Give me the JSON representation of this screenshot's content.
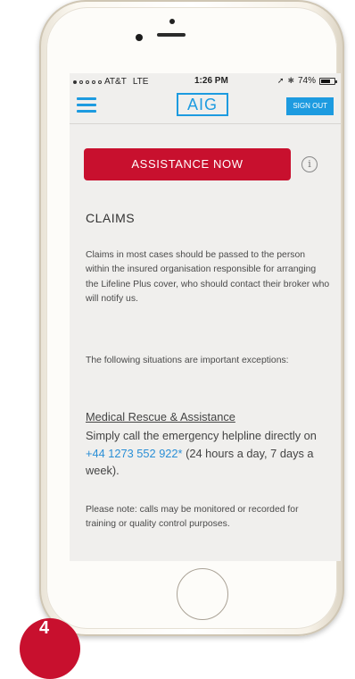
{
  "status_bar": {
    "carrier": "AT&T",
    "network": "LTE",
    "time": "1:26 PM",
    "battery": "74%",
    "battery_level": 0.74
  },
  "app_bar": {
    "logo": "AIG",
    "sign_out_label": "SIGN OUT"
  },
  "main": {
    "assistance_label": "ASSISTANCE NOW",
    "info_symbol": "i",
    "heading": "CLAIMS",
    "paragraph_1": "Claims in most cases should be passed to the person within the insured organisation responsible for arranging the Lifeline Plus cover, who should contact their broker who will notify us.",
    "paragraph_2": "The following situations are important exceptions:",
    "medical_title": "Medical Rescue & Assistance",
    "medical_text_before": "Simply call the emergency helpline directly on ",
    "medical_phone": "+44 1273 552 922*",
    "medical_text_after": " (24 hours a day, 7 days a week).",
    "paragraph_3": "Please note: calls may be monitored or recorded for training or quality control purposes."
  },
  "badge": {
    "number": "4",
    "color": "#c8102e"
  },
  "colors": {
    "brand_blue": "#1d9be0",
    "accent_red": "#c8102e",
    "screen_background": "#f0efed"
  }
}
